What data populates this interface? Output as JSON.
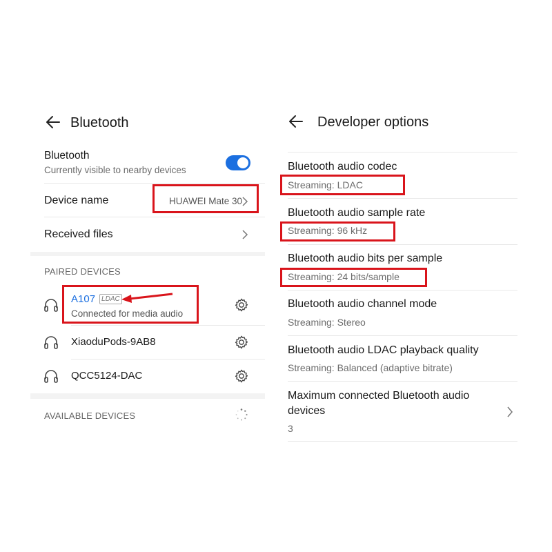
{
  "left": {
    "title": "Bluetooth",
    "bluetooth_row": {
      "label": "Bluetooth",
      "sub": "Currently visible to nearby devices",
      "toggle_on": true
    },
    "device_name": {
      "label": "Device name",
      "value": "HUAWEI Mate 30"
    },
    "received_files": {
      "label": "Received files"
    },
    "paired_header": "PAIRED DEVICES",
    "paired": [
      {
        "name": "A107",
        "badge": "LDAC",
        "status": "Connected for media audio"
      },
      {
        "name": "XiaoduPods-9AB8"
      },
      {
        "name": "QCC5124-DAC"
      }
    ],
    "available_header": "AVAILABLE DEVICES"
  },
  "right": {
    "title": "Developer options",
    "items": [
      {
        "label": "Bluetooth audio codec",
        "value": "Streaming: LDAC"
      },
      {
        "label": "Bluetooth audio sample rate",
        "value": "Streaming: 96 kHz"
      },
      {
        "label": "Bluetooth audio bits per sample",
        "value": "Streaming: 24 bits/sample"
      },
      {
        "label": "Bluetooth audio channel mode",
        "value": "Streaming: Stereo"
      },
      {
        "label": "Bluetooth audio LDAC playback quality",
        "value": "Streaming: Balanced (adaptive bitrate)"
      }
    ],
    "max_devices": {
      "label_line1": "Maximum connected Bluetooth audio",
      "label_line2": "devices",
      "value": "3"
    }
  },
  "colors": {
    "accent": "#1b6fe0",
    "annotation_red": "#d9141b"
  }
}
